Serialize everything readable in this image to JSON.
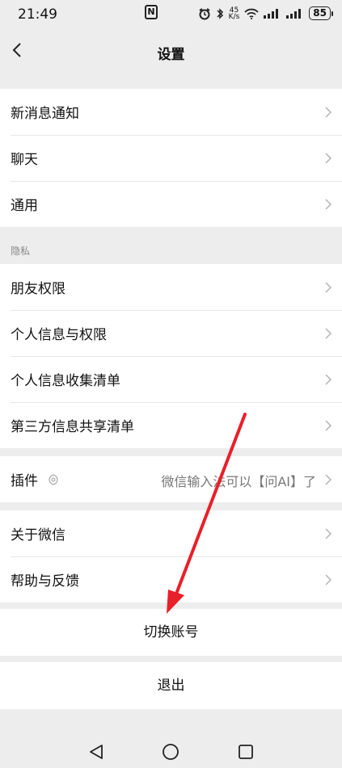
{
  "status_bar": {
    "time": "21:49",
    "nfc": "N",
    "net_speed_top": "45",
    "net_speed_bottom": "K/s",
    "battery": "85"
  },
  "header": {
    "title": "设置"
  },
  "groups": {
    "notifications": {
      "label": "新消息通知"
    },
    "chat": {
      "label": "聊天"
    },
    "general": {
      "label": "通用"
    }
  },
  "privacy": {
    "section_label": "隐私",
    "friends_permission": "朋友权限",
    "personal_info_permission": "个人信息与权限",
    "personal_info_collection": "个人信息收集清单",
    "third_party_sharing": "第三方信息共享清单"
  },
  "plugins": {
    "label": "插件",
    "value": "微信输入法可以【问AI】了"
  },
  "about": {
    "about_wechat": "关于微信",
    "help_feedback": "帮助与反馈"
  },
  "actions": {
    "switch_account": "切换账号",
    "logout": "退出"
  },
  "colors": {
    "background": "#ededed",
    "annotation_arrow": "#e8202a"
  }
}
